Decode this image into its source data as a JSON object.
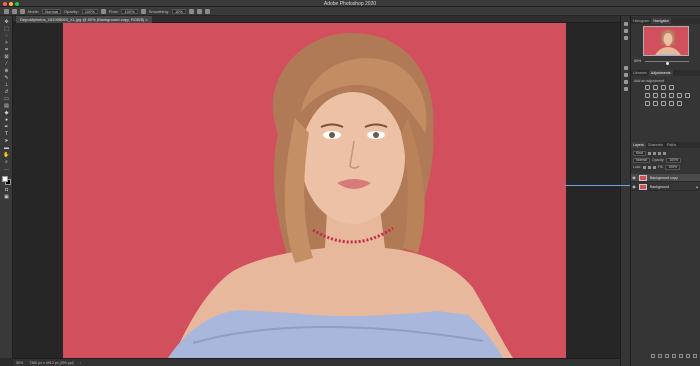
{
  "app": {
    "title": "Adobe Photoshop 2020",
    "traffic_lights": [
      "#ff5f57",
      "#febc2e",
      "#28c840"
    ]
  },
  "options_bar": {
    "mode_label": "Mode:",
    "mode_value": "Normal",
    "opacity_label": "Opacity:",
    "opacity_value": "100%",
    "flow_label": "Flow:",
    "flow_value": "100%",
    "smoothing_label": "Smoothing:",
    "smoothing_value": "10%"
  },
  "document": {
    "tab_label": "Depositphotos_151005053_XL.jpg @ 50% (Background copy, RGB/8)",
    "background_color": "#d2505e"
  },
  "status_bar": {
    "zoom": "50%",
    "doc_info": "7360 px x 4912 px (300 ppi)"
  },
  "navigator": {
    "tabs": [
      "Histogram",
      "Navigator"
    ],
    "active_tab": "Navigator",
    "zoom": "50%",
    "zoom_level": 0.5
  },
  "adjustments": {
    "tabs": [
      "Libraries",
      "Adjustments"
    ],
    "active_tab": "Adjustments",
    "hint": "Add an adjustment"
  },
  "layers": {
    "tabs": [
      "Layers",
      "Channels",
      "Paths"
    ],
    "active_tab": "Layers",
    "filter_label": "Kind",
    "blend_mode": "Normal",
    "opacity_label": "Opacity:",
    "opacity_value": "100%",
    "lock_label": "Lock:",
    "fill_label": "Fill:",
    "fill_value": "100%",
    "items": [
      {
        "name": "Background copy",
        "selected": true,
        "locked": false
      },
      {
        "name": "Background",
        "selected": false,
        "locked": true
      }
    ]
  },
  "colors": {
    "accent": "#6ca3e0",
    "canvas_bg": "#d2505e",
    "ui_dark": "#2b2b2b"
  }
}
